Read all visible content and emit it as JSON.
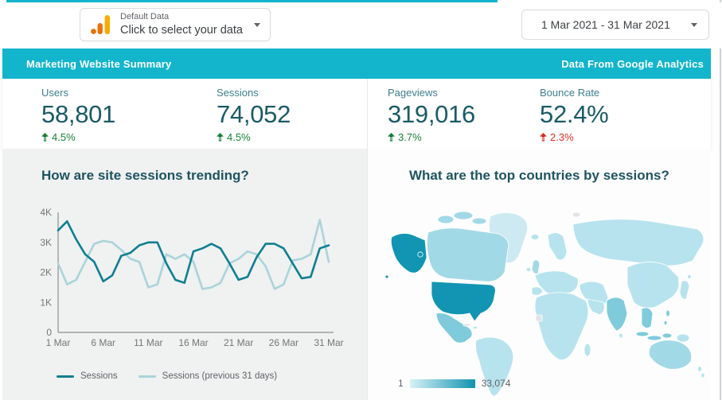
{
  "connector": {
    "title": "Default Data",
    "subtitle": "Click to select your data"
  },
  "date_range": {
    "value": "1 Mar 2021 - 31 Mar 2021"
  },
  "banner": {
    "title": "Marketing Website Summary",
    "right_text": "Data From Google Analytics"
  },
  "scorecards": [
    {
      "label": "Users",
      "value": "58,801",
      "delta": "4.5%",
      "direction": "up",
      "trend": "positive"
    },
    {
      "label": "Sessions",
      "value": "74,052",
      "delta": "4.5%",
      "direction": "up",
      "trend": "positive"
    },
    {
      "label": "Pageviews",
      "value": "319,016",
      "delta": "3.7%",
      "direction": "up",
      "trend": "positive"
    },
    {
      "label": "Bounce Rate",
      "value": "52.4%",
      "delta": "2.3%",
      "direction": "up",
      "trend": "negative"
    }
  ],
  "colors": {
    "accent_teal": "#12b5cb",
    "title_teal": "#1d5460",
    "metric_value": "#1a5b66",
    "metric_label": "#3d7f8d",
    "delta_up_good": "#188038",
    "delta_up_bad": "#d93025",
    "series_current": "#0e7f93",
    "series_previous": "#a9d4da",
    "axis_text": "#757575",
    "axis_line": "#8a8f94",
    "map": {
      "base": "#b7e3ee",
      "light": "#cdeaf3",
      "medium": "#7fcbdc",
      "medium_light": "#a2d9e7",
      "dark": "#1295b2",
      "nodata": "#e2e3e4",
      "legend_from": "#d8f1f7",
      "legend_to": "#0f93b0"
    }
  },
  "chart_data": [
    {
      "type": "line",
      "title": "How are site sessions trending?",
      "x": [
        "1 Mar",
        "2 Mar",
        "3 Mar",
        "4 Mar",
        "5 Mar",
        "6 Mar",
        "7 Mar",
        "8 Mar",
        "9 Mar",
        "10 Mar",
        "11 Mar",
        "12 Mar",
        "13 Mar",
        "14 Mar",
        "15 Mar",
        "16 Mar",
        "17 Mar",
        "18 Mar",
        "19 Mar",
        "20 Mar",
        "21 Mar",
        "22 Mar",
        "23 Mar",
        "24 Mar",
        "25 Mar",
        "26 Mar",
        "27 Mar",
        "28 Mar",
        "29 Mar",
        "30 Mar",
        "31 Mar"
      ],
      "x_ticks_shown": [
        "1 Mar",
        "6 Mar",
        "11 Mar",
        "16 Mar",
        "21 Mar",
        "26 Mar",
        "31 Mar"
      ],
      "y_ticks": [
        {
          "v": 0,
          "label": "0"
        },
        {
          "v": 1000,
          "label": "1K"
        },
        {
          "v": 2000,
          "label": "2K"
        },
        {
          "v": 3000,
          "label": "3K"
        },
        {
          "v": 4000,
          "label": "4K"
        }
      ],
      "ylim": [
        0,
        4000
      ],
      "grid": false,
      "legend_position": "bottom",
      "series": [
        {
          "name": "Sessions",
          "color_key": "series_current",
          "values": [
            3400,
            3700,
            3100,
            2600,
            2350,
            1700,
            1900,
            2550,
            2650,
            2900,
            3000,
            3000,
            2300,
            1750,
            1650,
            2700,
            2800,
            2950,
            2800,
            2300,
            1750,
            1850,
            2500,
            2950,
            2950,
            2800,
            2300,
            1800,
            1850,
            2800,
            2900
          ]
        },
        {
          "name": "Sessions (previous 31 days)",
          "color_key": "series_previous",
          "values": [
            2300,
            1600,
            1750,
            2350,
            2950,
            3050,
            3000,
            2750,
            2450,
            2350,
            1500,
            1600,
            2600,
            2450,
            2600,
            2350,
            1450,
            1500,
            1650,
            2300,
            2450,
            2700,
            2600,
            2200,
            1450,
            1600,
            2400,
            2450,
            2600,
            3750,
            2350
          ]
        }
      ]
    },
    {
      "type": "choropleth",
      "title": "What are the top countries by sessions?",
      "metric": "Sessions",
      "legend": {
        "min": "1",
        "max": "33,074"
      },
      "darkest_region": "United States"
    }
  ]
}
